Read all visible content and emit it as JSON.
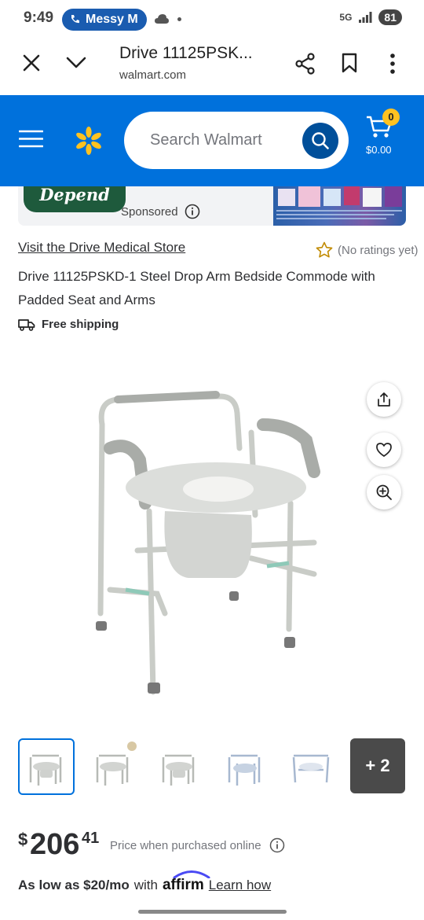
{
  "status_bar": {
    "time": "9:49",
    "call_label": "Messy M",
    "network": "5G",
    "battery": "81"
  },
  "browser": {
    "page_title": "Drive 11125PSK...",
    "url": "walmart.com"
  },
  "header": {
    "search_placeholder": "Search Walmart",
    "cart_count": "0",
    "cart_total": "$0.00",
    "brand_color": "#0071dc",
    "spark_color": "#ffc220"
  },
  "ad": {
    "brand": "Depend",
    "sponsored_label": "Sponsored"
  },
  "product": {
    "store_link": "Visit the Drive Medical Store",
    "ratings": "(No ratings yet)",
    "title": "Drive 11125PSKD-1 Steel Drop Arm Bedside Commode with Padded Seat and Arms",
    "shipping": "Free shipping",
    "more_images": "+ 2"
  },
  "price": {
    "currency": "$",
    "dollars": "206",
    "cents": "41",
    "note": "Price when purchased online"
  },
  "financing": {
    "as_low_as": "As low as $20/mo",
    "with": "with",
    "provider": "affirm",
    "learn_how": "Learn how"
  }
}
